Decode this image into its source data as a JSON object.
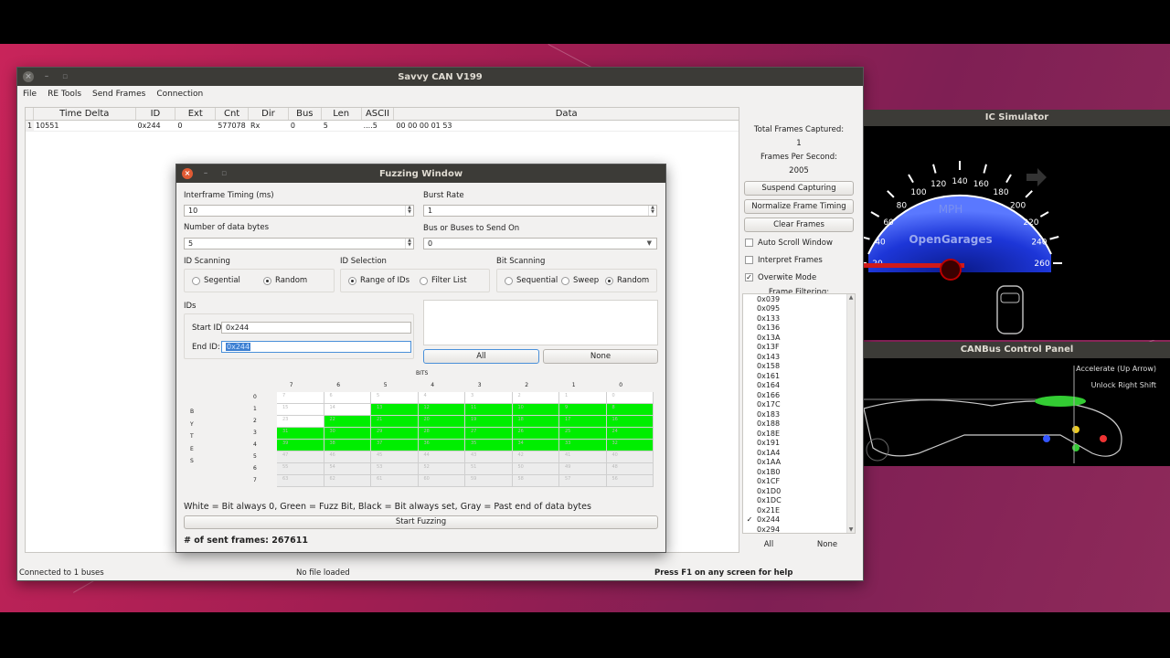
{
  "main_window": {
    "title": "Savvy CAN V199",
    "menu": [
      "File",
      "RE Tools",
      "Send Frames",
      "Connection"
    ],
    "table": {
      "headers": [
        "Time Delta",
        "ID",
        "Ext",
        "Cnt",
        "Dir",
        "Bus",
        "Len",
        "ASCII",
        "Data"
      ],
      "rows": [
        {
          "num": "1",
          "time_delta": "10551",
          "id": "0x244",
          "ext": "0",
          "cnt": "577078",
          "dir": "Rx",
          "bus": "0",
          "len": "5",
          "ascii": "....5",
          "data": "00 00 00 01 53"
        }
      ]
    },
    "side_panel": {
      "total_frames_label": "Total Frames Captured:",
      "total_frames_value": "1",
      "fps_label": "Frames Per Second:",
      "fps_value": "2005",
      "suspend_button": "Suspend Capturing",
      "normalize_button": "Normalize Frame Timing",
      "clear_button": "Clear Frames",
      "auto_scroll_label": "Auto Scroll Window",
      "interpret_label": "Interpret Frames",
      "overwrite_label": "Overwite Mode",
      "frame_filtering_label": "Frame Filtering:",
      "filter_ids": [
        "0x039",
        "0x095",
        "0x133",
        "0x136",
        "0x13A",
        "0x13F",
        "0x143",
        "0x158",
        "0x161",
        "0x164",
        "0x166",
        "0x17C",
        "0x183",
        "0x188",
        "0x18E",
        "0x191",
        "0x1A4",
        "0x1AA",
        "0x1B0",
        "0x1CF",
        "0x1D0",
        "0x1DC",
        "0x21E",
        "0x244",
        "0x294"
      ],
      "checked_id": "0x244",
      "all_button": "All",
      "none_button": "None"
    },
    "status": {
      "connection": "Connected to 1 buses",
      "file": "No file loaded",
      "help": "Press F1 on any screen for help"
    }
  },
  "fuzzing_window": {
    "title": "Fuzzing Window",
    "interframe_label": "Interframe Timing (ms)",
    "interframe_value": "10",
    "burst_label": "Burst Rate",
    "burst_value": "1",
    "num_bytes_label": "Number of data bytes",
    "num_bytes_value": "5",
    "bus_label": "Bus or Buses to Send On",
    "bus_value": "0",
    "id_scanning_label": "ID Scanning",
    "id_scan_sequential": "Segential",
    "id_scan_random": "Random",
    "id_selection_label": "ID Selection",
    "id_sel_range": "Range of IDs",
    "id_sel_filter": "Filter List",
    "bit_scanning_label": "Bit Scanning",
    "bit_scan_sequential": "Sequential",
    "bit_scan_sweep": "Sweep",
    "bit_scan_random": "Random",
    "ids_label": "IDs",
    "start_id_label": "Start ID:",
    "start_id_value": "0x244",
    "end_id_label": "End ID:",
    "end_id_value": "0x244",
    "all_button": "All",
    "none_button": "None",
    "bits_label": "BITS",
    "bit_columns": [
      "7",
      "6",
      "5",
      "4",
      "3",
      "2",
      "1",
      "0"
    ],
    "byte_rows": [
      "0",
      "1",
      "2",
      "3",
      "4",
      "5",
      "6",
      "7"
    ],
    "byte_letters": [
      "B",
      "Y",
      "T",
      "E",
      "S"
    ],
    "legend": "White = Bit always 0, Green = Fuzz Bit, Black = Bit always set, Gray = Past end of data bytes",
    "start_button": "Start Fuzzing",
    "sent_frames": "# of sent frames: 267611",
    "colors": {
      "fuzz": "#00ee00",
      "zero": "#ffffff",
      "past_end": "#ececec"
    }
  },
  "ic_simulator": {
    "title": "IC Simulator",
    "unit": "MPH",
    "brand": "OpenGarages",
    "speed_ticks": [
      "20",
      "40",
      "60",
      "80",
      "100",
      "120",
      "140",
      "160",
      "180",
      "200",
      "220",
      "240",
      "260"
    ]
  },
  "control_panel": {
    "title": "CANBus Control Panel",
    "hint_top": "Accelerate (Up Arrow)",
    "hint_right": "Unlock Right Shift"
  }
}
